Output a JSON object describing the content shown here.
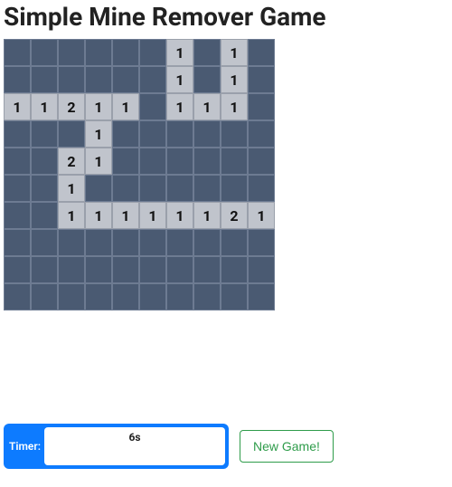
{
  "title": "Simple Mine Remover Game",
  "board": {
    "rows": 10,
    "cols": 10,
    "cells": [
      [
        null,
        null,
        null,
        null,
        null,
        null,
        "1",
        null,
        "1",
        null
      ],
      [
        null,
        null,
        null,
        null,
        null,
        null,
        "1",
        null,
        "1",
        null
      ],
      [
        "1",
        "1",
        "2",
        "1",
        "1",
        null,
        "1",
        "1",
        "1",
        null
      ],
      [
        null,
        null,
        null,
        "1",
        null,
        null,
        null,
        null,
        null,
        null
      ],
      [
        null,
        null,
        "2",
        "1",
        null,
        null,
        null,
        null,
        null,
        null
      ],
      [
        null,
        null,
        "1",
        null,
        null,
        null,
        null,
        null,
        null,
        null
      ],
      [
        null,
        null,
        "1",
        "1",
        "1",
        "1",
        "1",
        "1",
        "2",
        "1"
      ],
      [
        null,
        null,
        null,
        null,
        null,
        null,
        null,
        null,
        null,
        null
      ],
      [
        null,
        null,
        null,
        null,
        null,
        null,
        null,
        null,
        null,
        null
      ],
      [
        null,
        null,
        null,
        null,
        null,
        null,
        null,
        null,
        null,
        null
      ]
    ]
  },
  "timer": {
    "label": "Timer:",
    "value": "6s"
  },
  "buttons": {
    "newgame": "New Game!"
  }
}
